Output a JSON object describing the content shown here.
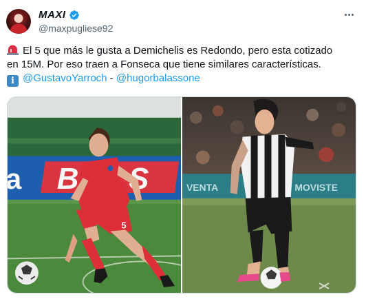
{
  "author": {
    "display_name": "MAXI",
    "handle": "@maxpugliese92",
    "verified": true
  },
  "tweet": {
    "line1": "El 5 que más le gusta a Demichelis es Redondo, pero esta cotizado",
    "line2": "en 15M. Por eso traen a Fonseca que tiene similares características.",
    "mention1": "@GustavoYarroch",
    "separator": " - ",
    "mention2": "@hugorbalassone",
    "emoji_first": "siren-emoji",
    "emoji_second": "information-emoji"
  },
  "media": {
    "photo1": {
      "jersey_number": "5",
      "ad_text": "BASS",
      "ad_prefix": "a"
    },
    "photo2": {
      "ad_text_left": "VENTA",
      "ad_text_right": "MOVISTE"
    }
  },
  "colors": {
    "link": "#1d9bf0",
    "verified": "#1d9bf0",
    "secondary_text": "#536471",
    "argentinos_red": "#e5323b",
    "riestra_stripes": "#1a1a1a"
  }
}
